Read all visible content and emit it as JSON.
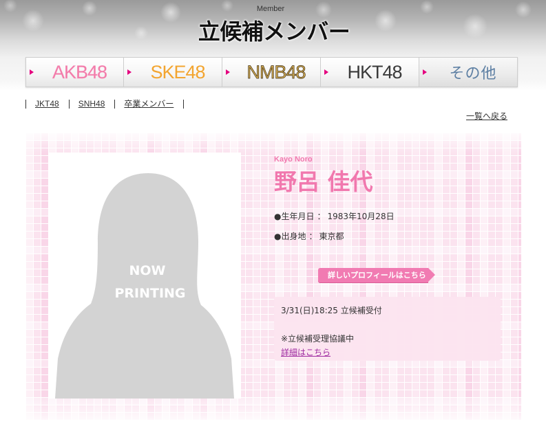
{
  "header": {
    "subtitle": "Member",
    "title": "立候補メンバー"
  },
  "group_tabs": [
    {
      "label": "AKB48",
      "color": "#f27aa8"
    },
    {
      "label": "SKE48",
      "color": "#f3a530"
    },
    {
      "label": "NMB48",
      "color": "#d4ad55"
    },
    {
      "label": "HKT48",
      "color": "#3a3a3a"
    },
    {
      "label": "その他",
      "color": "#5d7fa3"
    }
  ],
  "sub_nav": [
    "JKT48",
    "SNH48",
    "卒業メンバー"
  ],
  "back_link": "一覧へ戻る",
  "member": {
    "name_romaji": "Kayo Noro",
    "name": "野呂 佳代",
    "birthday_label": "●生年月日",
    "birthday": "1983年10月28日",
    "birthplace_label": "●出身地",
    "birthplace": "東京都",
    "separator": "：",
    "photo_placeholder": [
      "NOW",
      "PRINTING"
    ]
  },
  "profile_button": "詳しいプロフィールはこちら",
  "status_box": {
    "registration": "3/31(日)18:25 立候補受付",
    "note": "※立候補受理協議中",
    "detail_link": "詳細はこちら"
  },
  "colors": {
    "tab_arrow": "#e4007f",
    "member_name": "#f178ae",
    "profile_button": "#f17bb2",
    "status_box": "#fce4f0",
    "detail_link": "#9e2aa0"
  },
  "icons": [
    "arrow-right-icon"
  ]
}
